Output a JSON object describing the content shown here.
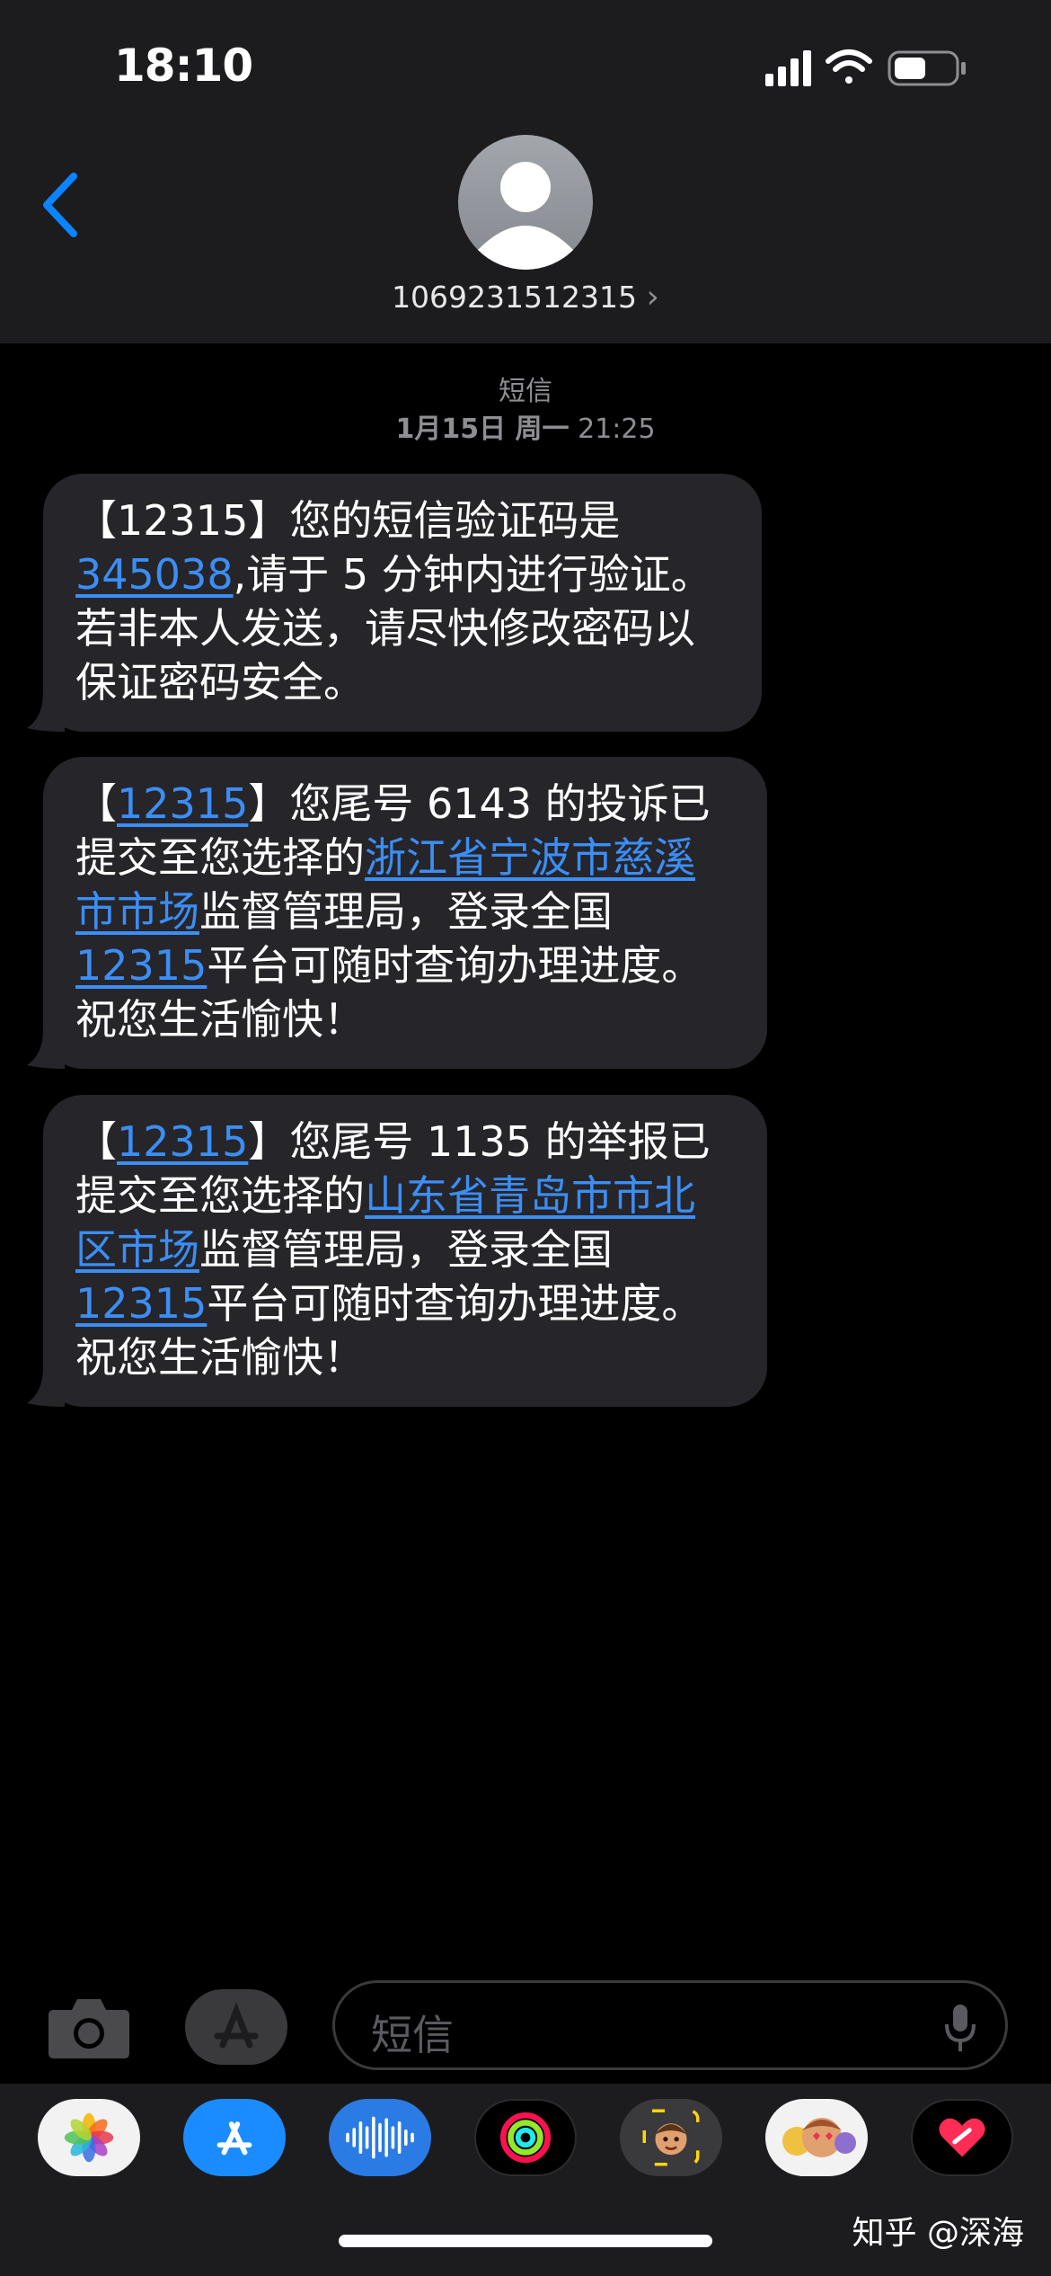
{
  "status": {
    "time": "18:10"
  },
  "header": {
    "contact": "1069231512315",
    "chevron": "›"
  },
  "timestamp": {
    "label": "短信",
    "date": "1月15日 周一",
    "time": "21:25"
  },
  "messages": [
    {
      "segments": [
        {
          "t": "【12315】您的短信验证码是"
        },
        {
          "t": "345038",
          "link": true
        },
        {
          "t": ",请于 5 分钟内进行验证。若非本人发送，请尽快修改密码以保证密码安全。"
        }
      ]
    },
    {
      "segments": [
        {
          "t": "【"
        },
        {
          "t": "12315",
          "link": true
        },
        {
          "t": "】您尾号 6143 的投诉已提交至您选择的"
        },
        {
          "t": "浙江省宁波市慈溪市市场",
          "link": true
        },
        {
          "t": "监督管理局，登录全国"
        },
        {
          "t": "12315",
          "link": true
        },
        {
          "t": "平台可随时查询办理进度。祝您生活愉快！"
        }
      ]
    },
    {
      "segments": [
        {
          "t": "【"
        },
        {
          "t": "12315",
          "link": true
        },
        {
          "t": "】您尾号 1135 的举报已提交至您选择的"
        },
        {
          "t": "山东省青岛市市北区市场",
          "link": true
        },
        {
          "t": "监督管理局，登录全国"
        },
        {
          "t": "12315",
          "link": true
        },
        {
          "t": "平台可随时查询办理进度。祝您生活愉快！"
        }
      ]
    }
  ],
  "input": {
    "placeholder": "短信"
  },
  "apps": [
    "photos",
    "app-store",
    "audio-messages",
    "activity",
    "memoji",
    "memoji-stickers",
    "digital-touch"
  ],
  "watermark": "知乎 @深海",
  "colors": {
    "link": "#3b8ef5",
    "bubble": "#26252a",
    "header": "#1c1c1e",
    "accent": "#0a84ff"
  }
}
